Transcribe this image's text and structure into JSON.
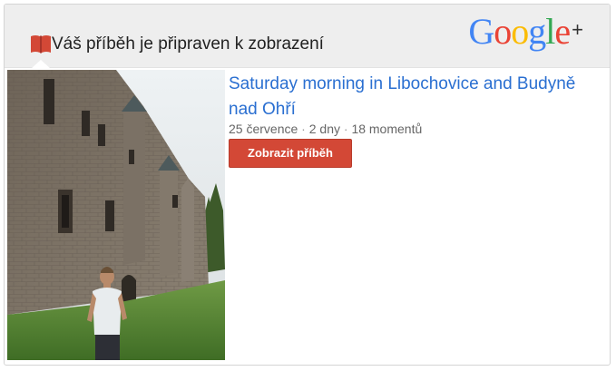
{
  "header": {
    "title": "Váš příběh je připraven k zobrazení",
    "icon": "book-icon",
    "logo": {
      "text_parts": [
        "G",
        "o",
        "o",
        "g",
        "l",
        "e"
      ],
      "plus": "+"
    }
  },
  "story": {
    "title": "Saturday morning in Libochovice and Budyně nad Ohří",
    "meta": {
      "date": "25 července",
      "separator": "·",
      "duration": "2 dny",
      "moments": "18 momentů"
    },
    "button_label": "Zobrazit příběh"
  },
  "colors": {
    "accent_button": "#d34836",
    "link": "#2a6fd1",
    "book_icon": "#d34836",
    "google_blue": "#4285f4",
    "google_red": "#ea4335",
    "google_yellow": "#fbbc05",
    "google_green": "#34a853"
  }
}
